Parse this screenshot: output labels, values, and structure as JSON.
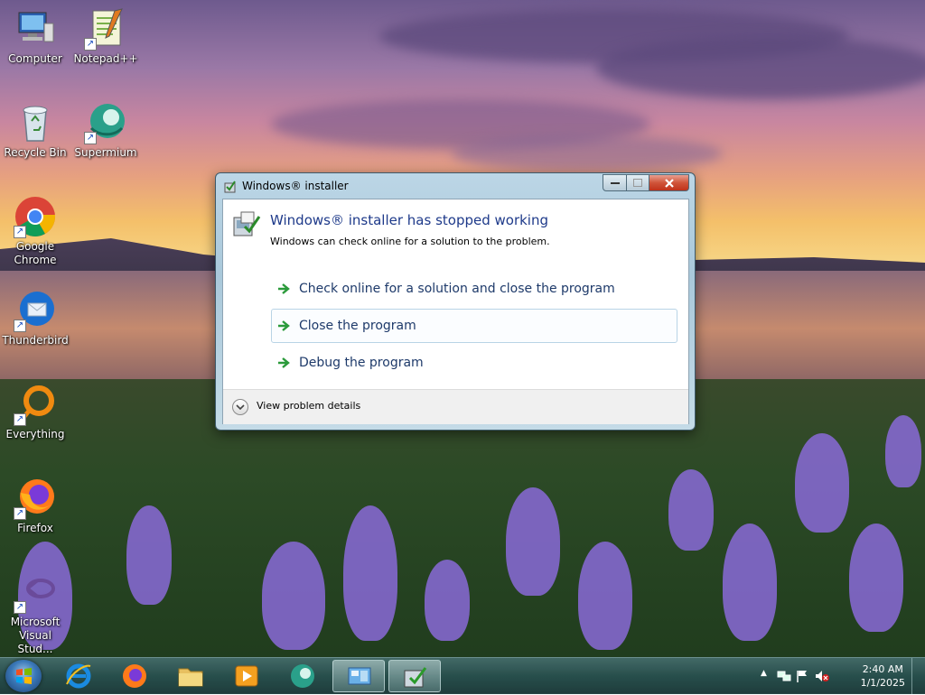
{
  "desktop": {
    "icons": [
      {
        "label": "Computer"
      },
      {
        "label": "Notepad++"
      },
      {
        "label": "Recycle Bin"
      },
      {
        "label": "Supermium"
      },
      {
        "label": "Google Chrome"
      },
      {
        "label": "Thunderbird"
      },
      {
        "label": "Everything"
      },
      {
        "label": "Firefox"
      },
      {
        "label": "Microsoft Visual Stud..."
      }
    ]
  },
  "dialog": {
    "title": "Windows® installer",
    "heading": "Windows® installer has stopped working",
    "subtext": "Windows can check online for a solution to the problem.",
    "options": [
      {
        "label": "Check online for a solution and close the program"
      },
      {
        "label": "Close the program"
      },
      {
        "label": "Debug the program"
      }
    ],
    "details_label": "View problem details",
    "accent_color": "#1e3a8a"
  },
  "taskbar": {
    "clock_time": "2:40 AM",
    "clock_date": "1/1/2025",
    "tray_overflow_glyph": "▲"
  }
}
